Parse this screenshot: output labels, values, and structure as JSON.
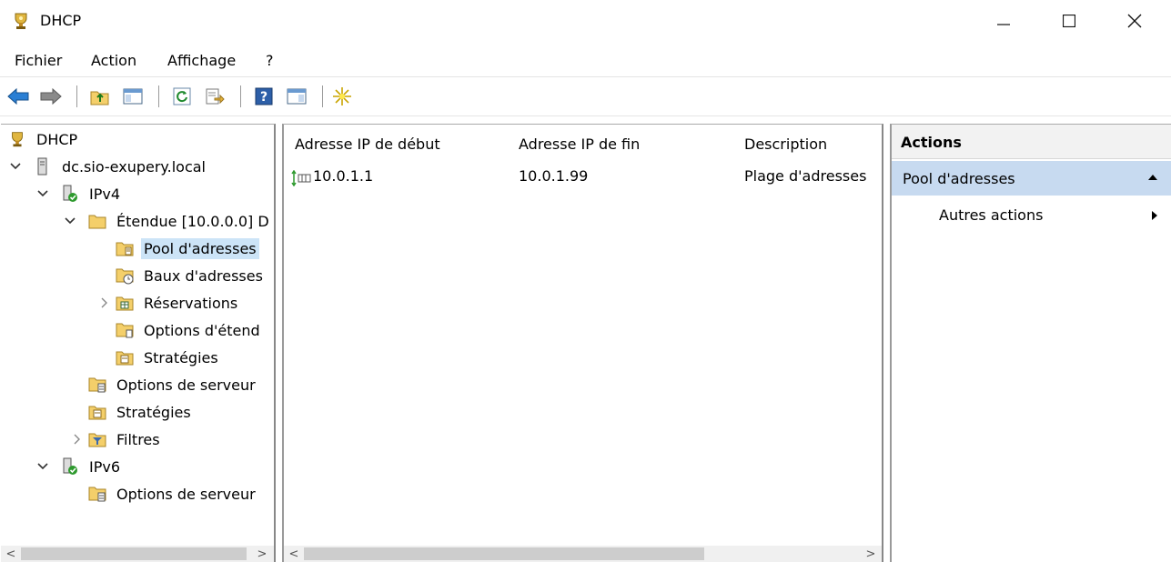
{
  "window": {
    "title": "DHCP",
    "controls": {
      "minimize": "—",
      "maximize": "☐",
      "close": "✕"
    }
  },
  "menu": [
    "Fichier",
    "Action",
    "Affichage",
    "?"
  ],
  "toolbar": {
    "icons": [
      "back-arrow-icon",
      "forward-arrow-icon",
      "up-folder-icon",
      "show-hide-tree-icon",
      "refresh-icon",
      "export-list-icon",
      "help-icon",
      "show-hide-action-pane-icon",
      "new-item-star-icon"
    ]
  },
  "tree": {
    "items": [
      {
        "label": "DHCP"
      },
      {
        "label": "dc.sio-exupery.local"
      },
      {
        "label": "IPv4"
      },
      {
        "label": "Étendue [10.0.0.0] D"
      },
      {
        "label": "Pool d'adresses"
      },
      {
        "label": "Baux d'adresses"
      },
      {
        "label": "Réservations"
      },
      {
        "label": "Options d'étend"
      },
      {
        "label": "Stratégies"
      },
      {
        "label": "Options de serveur"
      },
      {
        "label": "Stratégies"
      },
      {
        "label": "Filtres"
      },
      {
        "label": "IPv6"
      },
      {
        "label": "Options de serveur"
      }
    ]
  },
  "list": {
    "columns": [
      "Adresse IP de début",
      "Adresse IP de fin",
      "Description"
    ],
    "rows": [
      {
        "start": "10.0.1.1",
        "end": "10.0.1.99",
        "description": "Plage d'adresses p"
      }
    ]
  },
  "scroll": {
    "left_arrow": "<",
    "right_arrow": ">"
  },
  "actions": {
    "header": "Actions",
    "section": "Pool d'adresses",
    "more": "Autres actions"
  },
  "colors": {
    "selection": "#cce4f7",
    "action_section": "#c7daf0",
    "folder": "#f4cf6a"
  }
}
